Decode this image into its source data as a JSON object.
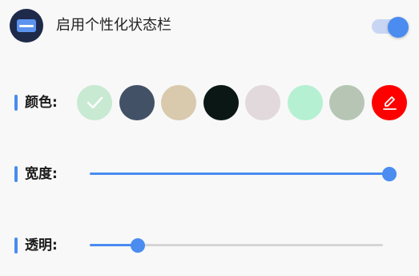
{
  "header": {
    "icon": "status-bar-icon",
    "title": "启用个性化状态栏",
    "toggle_on": true,
    "accent_color": "#4a8cf0"
  },
  "color_section": {
    "label": "颜色:",
    "swatches": [
      {
        "color": "#c8e9d2",
        "selected": true,
        "icon": "check-icon"
      },
      {
        "color": "#435166",
        "selected": false
      },
      {
        "color": "#d9c9ad",
        "selected": false
      },
      {
        "color": "#0b1715",
        "selected": false
      },
      {
        "color": "#e1d9db",
        "selected": false
      },
      {
        "color": "#b5f0d2",
        "selected": false
      },
      {
        "color": "#b6c5b4",
        "selected": false
      },
      {
        "color": "#ff0000",
        "selected": false,
        "icon": "edit-icon"
      }
    ]
  },
  "width_section": {
    "label": "宽度:",
    "value": 1.0
  },
  "opacity_section": {
    "label": "透明:",
    "value": 0.16
  }
}
